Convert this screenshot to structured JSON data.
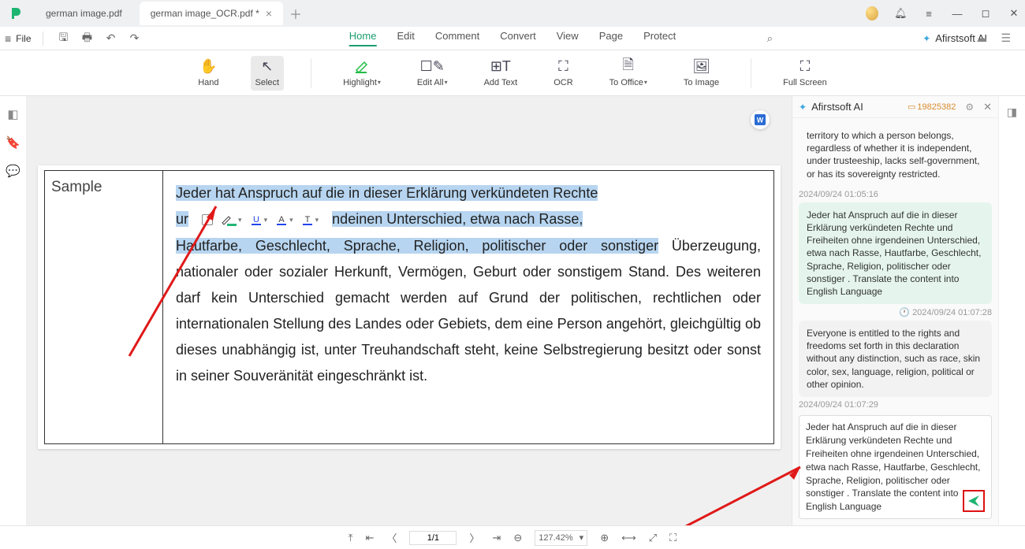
{
  "tabs": [
    {
      "label": "german image.pdf",
      "active": false
    },
    {
      "label": "german image_OCR.pdf *",
      "active": true
    }
  ],
  "file_menu": {
    "label": "File"
  },
  "menu": {
    "home": "Home",
    "edit": "Edit",
    "comment": "Comment",
    "convert": "Convert",
    "view": "View",
    "page": "Page",
    "protect": "Protect"
  },
  "ai_brand": "Afirstsoft AI",
  "toolbar": {
    "hand": "Hand",
    "select": "Select",
    "highlight": "Highlight",
    "editall": "Edit All",
    "addtext": "Add Text",
    "ocr": "OCR",
    "tooffice": "To Office",
    "toimage": "To Image",
    "fullscreen": "Full Screen"
  },
  "doc": {
    "sample_label": "Sample",
    "sel_head": "Jeder  hat  Anspruch  auf  die  in  dieser  Erklärung  verkündeten  Rechte",
    "sel_l2a": "ur",
    "sel_l2b": "ndeinen   Unterschied,   etwa   nach   Rasse,",
    "sel_l3": "Hautfarbe,   Geschlecht,   Sprache,   Religion,   politischer   oder   sonstiger",
    "rest": "Überzeugung,   nationaler   oder   sozialer   Herkunft,   Vermögen,   Geburt oder  sonstigem  Stand.  Des  weiteren  darf  kein  Unterschied  gemacht werden  auf  Grund  der  politischen,  rechtlichen  oder  internationalen Stellung   des   Landes   oder   Gebiets,   dem   eine   Person   angehört, gleichgültig   ob   dieses   unabhängig   ist,   unter   Treuhandschaft   steht, keine   Selbstregierung   besitzt   oder   sonst   in   seiner   Souveränität eingeschränkt ist."
  },
  "chat": {
    "title": "Afirstsoft AI",
    "credits": "19825382",
    "msg_intro": "territory to which a person belongs, regardless of whether it is independent, under trusteeship, lacks self-government, or has its sovereignty restricted.",
    "ts1": "2024/09/24 01:05:16",
    "msg_green": "Jeder hat Anspruch auf die in dieser Erklärung verkündeten Rechte und Freiheiten ohne irgendeinen Unterschied, etwa nach Rasse, Hautfarbe, Geschlecht, Sprache, Religion, politischer oder sonstiger . Translate the content into English Language",
    "ts2": "2024/09/24 01:07:28",
    "msg_reply": "Everyone is entitled to the rights and freedoms set forth in this declaration without any distinction, such as race, skin color, sex, language, religion, political or other opinion.",
    "ts3": "2024/09/24 01:07:29",
    "input_text": "Jeder hat Anspruch auf die in dieser Erklärung verkündeten Rechte und Freiheiten ohne irgendeinen Unterschied, etwa nach Rasse, Hautfarbe, Geschlecht, Sprache, Religion, politischer oder sonstiger . Translate the content into English Language"
  },
  "status": {
    "page": "1/1",
    "zoom": "127.42%"
  }
}
